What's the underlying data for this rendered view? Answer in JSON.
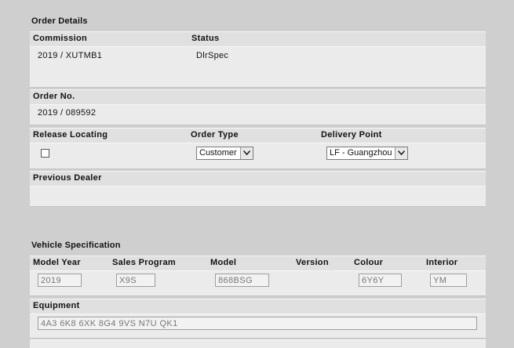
{
  "order_details": {
    "title": "Order Details",
    "commission_label": "Commission",
    "commission_value": "2019 / XUTMB1",
    "status_label": "Status",
    "status_value": "DlrSpec",
    "order_no_label": "Order No.",
    "order_no_value": "2019 / 089592",
    "release_locating_label": "Release Locating",
    "release_locating_checked": false,
    "order_type_label": "Order Type",
    "order_type_selected": "Customer",
    "delivery_point_label": "Delivery Point",
    "delivery_point_selected": "LF - Guangzhou",
    "previous_dealer_label": "Previous Dealer"
  },
  "vehicle_spec": {
    "title": "Vehicle Specification",
    "model_year_label": "Model Year",
    "model_year_value": "2019",
    "sales_program_label": "Sales Program",
    "sales_program_value": "X9S",
    "model_label": "Model",
    "model_value": "868BSG",
    "version_label": "Version",
    "colour_label": "Colour",
    "colour_value": "6Y6Y",
    "interior_label": "Interior",
    "interior_value": "YM",
    "equipment_label": "Equipment",
    "equipment_value": "4A3 6K8 6XK 8G4 9VS N7U QK1"
  }
}
